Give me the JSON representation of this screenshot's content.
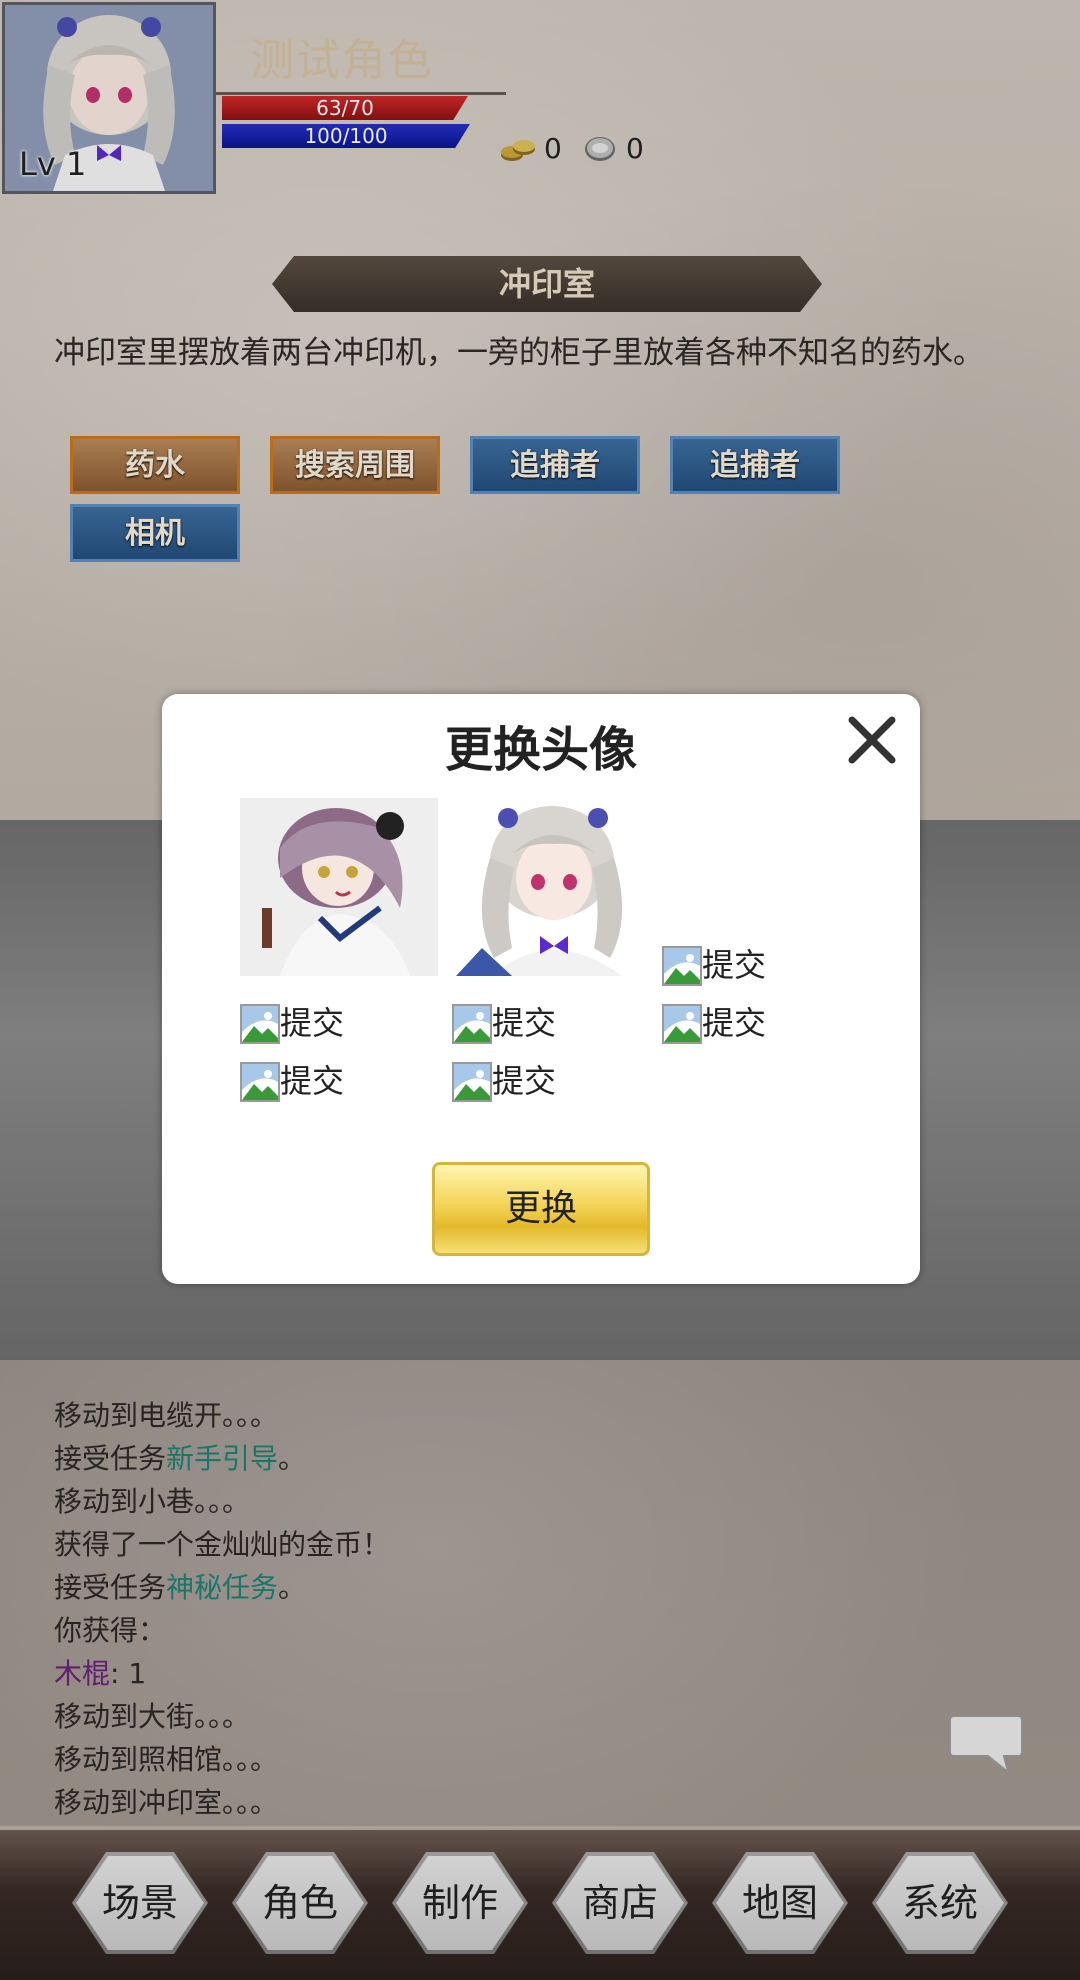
{
  "header": {
    "level": "Lv 1",
    "character_name": "测试角色",
    "hp": "63/70",
    "hp_fraction": 0.9,
    "mp": "100/100",
    "mp_fraction": 1.0,
    "gold": "0",
    "silver": "0"
  },
  "location": {
    "name": "冲印室",
    "description": "冲印室里摆放着两台冲印机，一旁的柜子里放着各种不知名的药水。"
  },
  "actions": [
    {
      "label": "药水",
      "kind": "item"
    },
    {
      "label": "搜索周围",
      "kind": "item"
    },
    {
      "label": "追捕者",
      "kind": "npc"
    },
    {
      "label": "追捕者",
      "kind": "npc"
    },
    {
      "label": "相机",
      "kind": "npc"
    }
  ],
  "modal": {
    "title": "更换头像",
    "broken_alt": "提交",
    "confirm_label": "更换"
  },
  "log": [
    {
      "parts": [
        {
          "t": "移动到电缆开。。。"
        }
      ]
    },
    {
      "parts": [
        {
          "t": "接受任务"
        },
        {
          "t": "新手引导",
          "c": "teal"
        },
        {
          "t": "。"
        }
      ]
    },
    {
      "parts": [
        {
          "t": "移动到小巷。。。"
        }
      ]
    },
    {
      "parts": [
        {
          "t": "获得了一个金灿灿的金币！"
        }
      ]
    },
    {
      "parts": [
        {
          "t": "接受任务"
        },
        {
          "t": "神秘任务",
          "c": "teal"
        },
        {
          "t": "。"
        }
      ]
    },
    {
      "parts": [
        {
          "t": "你获得："
        }
      ]
    },
    {
      "parts": [
        {
          "t": "木棍",
          "c": "purple"
        },
        {
          "t": ": 1"
        }
      ]
    },
    {
      "parts": [
        {
          "t": "移动到大街。。。"
        }
      ]
    },
    {
      "parts": [
        {
          "t": "移动到照相馆。。。"
        }
      ]
    },
    {
      "parts": [
        {
          "t": "移动到冲印室。。。"
        }
      ]
    }
  ],
  "nav": [
    "场景",
    "角色",
    "制作",
    "商店",
    "地图",
    "系统"
  ],
  "colors": {
    "hp": "#d12a2a",
    "mp": "#2630c8",
    "teal_text": "#1f7f73",
    "purple_text": "#6b1f7a",
    "confirm_gold": "#f4d458"
  }
}
